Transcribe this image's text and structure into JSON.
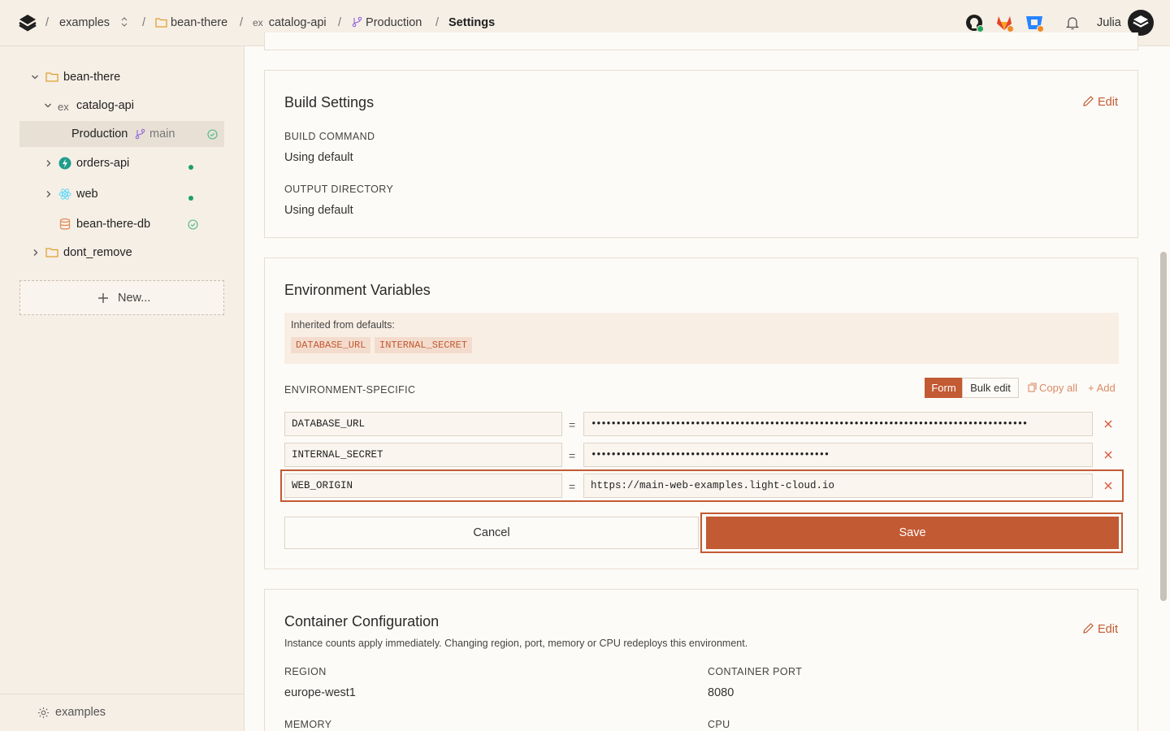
{
  "breadcrumb": {
    "workspace": "examples",
    "project": "bean-there",
    "service": "catalog-api",
    "environment": "Production",
    "page": "Settings",
    "separator": "/"
  },
  "header": {
    "user_name": "Julia",
    "icons": [
      "github-icon",
      "gitlab-icon",
      "bitbucket-icon",
      "bell-icon"
    ],
    "status_colors": {
      "github": "#22a55a",
      "gitlab": "#f08a24"
    }
  },
  "sidebar": {
    "items": [
      {
        "label": "bean-there",
        "icon": "folder-icon"
      },
      {
        "label": "catalog-api",
        "prefix": "ex",
        "icon": "service-icon"
      },
      {
        "label": "Production",
        "branch": "main",
        "icon": "branch-icon",
        "selected": true
      },
      {
        "label": "orders-api",
        "icon": "bolt-icon"
      },
      {
        "label": "web",
        "icon": "react-icon"
      },
      {
        "label": "bean-there-db",
        "icon": "database-icon"
      },
      {
        "label": "dont_remove",
        "icon": "folder-icon"
      }
    ],
    "new_label": "New...",
    "footer_label": "examples"
  },
  "build_settings": {
    "title": "Build Settings",
    "edit_label": "Edit",
    "build_command_label": "BUILD COMMAND",
    "build_command_value": "Using default",
    "output_directory_label": "OUTPUT DIRECTORY",
    "output_directory_value": "Using default"
  },
  "env_vars": {
    "title": "Environment Variables",
    "inherited_label": "Inherited from defaults:",
    "inherited": [
      "DATABASE_URL",
      "INTERNAL_SECRET"
    ],
    "specific_label": "ENVIRONMENT-SPECIFIC",
    "mode_form": "Form",
    "mode_bulk": "Bulk edit",
    "copy_all": "Copy all",
    "add": "Add",
    "equals": "=",
    "rows": [
      {
        "key": "DATABASE_URL",
        "value": "••••••••••••••••••••••••••••••••••••••••••••••••••••••••••••••••••••••••••••••••••••••••"
      },
      {
        "key": "INTERNAL_SECRET",
        "value": "••••••••••••••••••••••••••••••••••••••••••••••••"
      },
      {
        "key": "WEB_ORIGIN",
        "value": "https://main-web-examples.light-cloud.io"
      }
    ],
    "cancel_label": "Cancel",
    "save_label": "Save"
  },
  "container": {
    "title": "Container Configuration",
    "edit_label": "Edit",
    "description": "Instance counts apply immediately. Changing region, port, memory or CPU redeploys this environment.",
    "region_label": "REGION",
    "region_value": "europe-west1",
    "port_label": "CONTAINER PORT",
    "port_value": "8080",
    "memory_label": "MEMORY",
    "cpu_label": "CPU"
  },
  "colors": {
    "accent": "#c25a33",
    "status_green": "#1f9d6b"
  }
}
